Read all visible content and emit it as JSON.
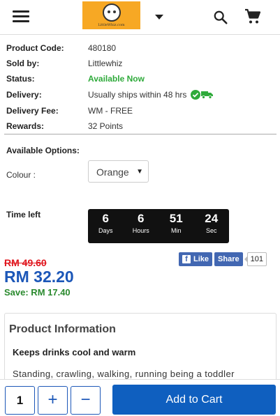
{
  "header": {
    "logo_text": "LittleWhiz.com"
  },
  "details": {
    "product_code_label": "Product Code:",
    "product_code": "480180",
    "sold_by_label": "Sold by:",
    "sold_by": "Littlewhiz",
    "status_label": "Status:",
    "status": "Available Now",
    "delivery_label": "Delivery:",
    "delivery": "Usually ships within 48 hrs",
    "delivery_fee_label": "Delivery Fee:",
    "delivery_fee": "WM - FREE",
    "rewards_label": "Rewards:",
    "rewards": "32 Points"
  },
  "options": {
    "title": "Available Options:",
    "colour_label": "Colour :",
    "colour_selected": "Orange"
  },
  "timer": {
    "label": "Time left",
    "units": [
      {
        "value": "6",
        "unit": "Days"
      },
      {
        "value": "6",
        "unit": "Hours"
      },
      {
        "value": "51",
        "unit": "Min"
      },
      {
        "value": "24",
        "unit": "Sec"
      }
    ]
  },
  "price": {
    "old": "RM 49.60",
    "new": "RM 32.20",
    "save": "Save: RM 17.40"
  },
  "social": {
    "like": "Like",
    "share": "Share",
    "count": "101"
  },
  "info": {
    "title": "Product Information",
    "subtitle": "Keeps drinks cool and warm",
    "text": "Standing, crawling, walking, running  being a toddler"
  },
  "cart": {
    "quantity": "1",
    "plus": "+",
    "minus": "−",
    "add_label": "Add to Cart"
  },
  "colors": {
    "brand_blue": "#0f5fbf",
    "status_green": "#2eaa3a",
    "old_price_red": "#e0161e",
    "logo_orange": "#f7a824"
  },
  "icons": [
    "menu-icon",
    "caret-down-icon",
    "search-icon",
    "cart-icon",
    "check-circle-icon",
    "truck-icon",
    "facebook-icon"
  ]
}
